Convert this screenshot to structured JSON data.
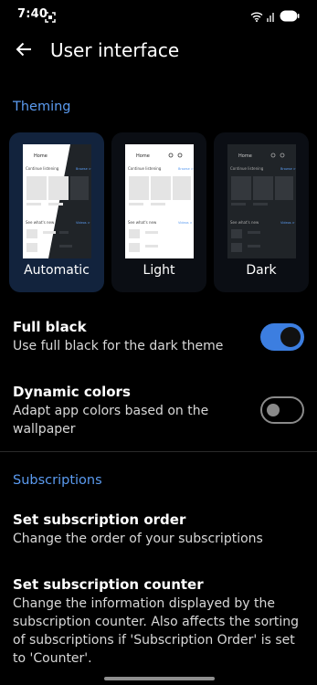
{
  "status_bar": {
    "time": "7:40"
  },
  "app_bar": {
    "title": "User interface"
  },
  "theming": {
    "header": "Theming",
    "preview": {
      "home": "Home",
      "continue": "Continue listening",
      "continue_action": "Browse >",
      "whats_new": "See what's new",
      "whats_new_action": "Videos >"
    },
    "options": [
      {
        "label": "Automatic",
        "selected": true
      },
      {
        "label": "Light",
        "selected": false
      },
      {
        "label": "Dark",
        "selected": false
      }
    ]
  },
  "full_black": {
    "title": "Full black",
    "summary": "Use full black for the dark theme",
    "enabled": true
  },
  "dynamic_colors": {
    "title": "Dynamic colors",
    "summary": "Adapt app colors based on the wallpaper",
    "enabled": false
  },
  "subscriptions": {
    "header": "Subscriptions",
    "order": {
      "title": "Set subscription order",
      "summary": "Change the order of your subscriptions"
    },
    "counter": {
      "title": "Set subscription counter",
      "summary": "Change the information displayed by the subscription counter. Also affects the sorting of subscriptions if 'Subscription Order' is set to 'Counter'."
    }
  },
  "colors": {
    "accent": "#5b9bf0",
    "toggle_on": "#3c7ee0",
    "selected_card": "#12233d"
  },
  "icons": [
    "screenshot-icon",
    "wifi-icon",
    "signal-icon",
    "battery-icon",
    "back-arrow-icon"
  ]
}
